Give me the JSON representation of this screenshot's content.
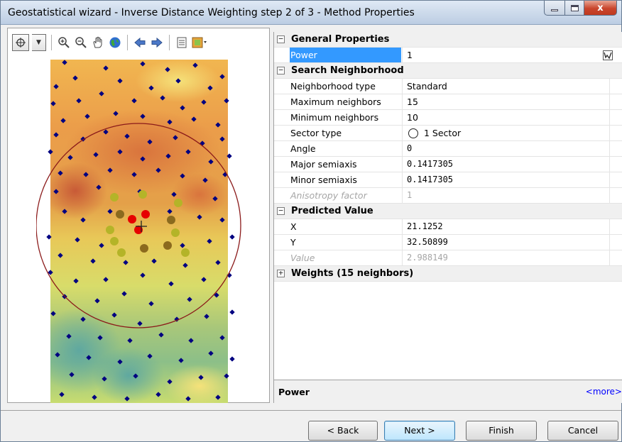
{
  "window": {
    "title": "Geostatistical wizard - Inverse Distance Weighting step 2 of 3 - Method Properties",
    "close_glyph": "x"
  },
  "toolbar": {
    "icons": [
      "select-tool-icon",
      "dropdown-arrow-icon",
      "zoom-in-icon",
      "zoom-out-icon",
      "pan-hand-icon",
      "full-extent-globe-icon",
      "back-arrow-icon",
      "forward-arrow-icon",
      "layer-list-icon",
      "map-options-icon"
    ]
  },
  "properties": {
    "general": {
      "title": "General Properties",
      "toggle": "−",
      "rows": [
        {
          "label": "Power",
          "value": "1"
        }
      ]
    },
    "search": {
      "title": "Search Neighborhood",
      "toggle": "−",
      "rows": [
        {
          "label": "Neighborhood type",
          "value": "Standard"
        },
        {
          "label": "Maximum neighbors",
          "value": "15"
        },
        {
          "label": "Minimum neighbors",
          "value": "10"
        },
        {
          "label": "Sector type",
          "value": "1 Sector"
        },
        {
          "label": "Angle",
          "value": "0"
        },
        {
          "label": "Major semiaxis",
          "value": "0.1417305"
        },
        {
          "label": "Minor semiaxis",
          "value": "0.1417305"
        },
        {
          "label": "Anisotropy factor",
          "value": "1"
        }
      ]
    },
    "predicted": {
      "title": "Predicted Value",
      "toggle": "−",
      "rows": [
        {
          "label": "X",
          "value": "21.1252"
        },
        {
          "label": "Y",
          "value": "32.50899"
        },
        {
          "label": "Value",
          "value": "2.988149"
        }
      ]
    },
    "weights": {
      "title": "Weights (15 neighbors)",
      "toggle": "+"
    }
  },
  "description": {
    "label": "Power",
    "more": "<more>"
  },
  "buttons": {
    "back": "< Back",
    "next": "Next >",
    "finish": "Finish",
    "cancel": "Cancel"
  },
  "colors": {
    "selection": "#3399ff",
    "search_circle": "#8b1a1a",
    "neighbor_high_weight": "#e60000",
    "neighbor_mid_weight": "#8b6a1e",
    "neighbor_low_weight": "#b4b428",
    "data_point": "#000080"
  }
}
